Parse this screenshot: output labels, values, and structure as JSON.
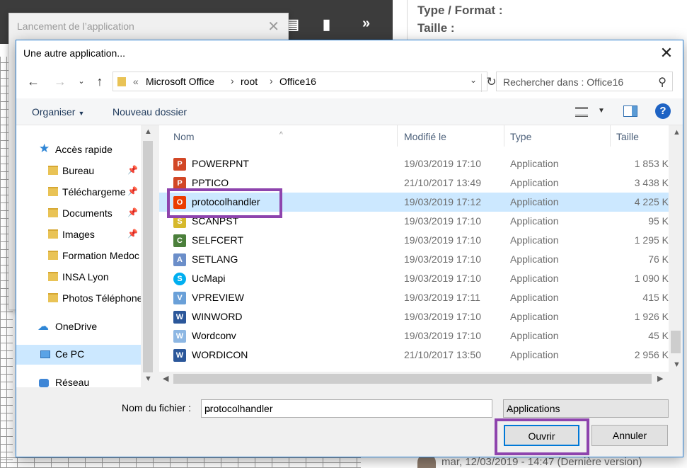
{
  "background": {
    "launcher_title": "Lancement de l’application",
    "type_format_label": "Type / Format :",
    "taille_label": "Taille :",
    "footer_text": "mar, 12/03/2019 - 14:47 (Dernière version)"
  },
  "dialog": {
    "title": "Une autre application...",
    "address": {
      "overflow": "«",
      "segments": [
        "Microsoft Office",
        "root",
        "Office16"
      ]
    },
    "search_placeholder": "Rechercher dans : Office16",
    "commands": {
      "organize": "Organiser",
      "new_folder": "Nouveau dossier"
    },
    "nav_items": [
      {
        "label": "Accès rapide",
        "icon": "star-icon"
      },
      {
        "label": "Bureau",
        "icon": "folder-icon",
        "pinned": true
      },
      {
        "label": "Téléchargements",
        "icon": "download-folder-icon",
        "pinned": true
      },
      {
        "label": "Documents",
        "icon": "documents-folder-icon",
        "pinned": true
      },
      {
        "label": "Images",
        "icon": "images-folder-icon",
        "pinned": true
      },
      {
        "label": "Formation Medoc",
        "icon": "folder-icon"
      },
      {
        "label": "INSA Lyon",
        "icon": "folder-icon"
      },
      {
        "label": "Photos Téléphone",
        "icon": "folder-icon"
      },
      {
        "label": "OneDrive",
        "icon": "cloud-icon"
      },
      {
        "label": "Ce PC",
        "icon": "computer-icon",
        "selected": true
      },
      {
        "label": "Réseau",
        "icon": "network-icon"
      }
    ],
    "columns": [
      "Nom",
      "Modifié le",
      "Type",
      "Taille"
    ],
    "files": [
      {
        "name": "POWERPNT",
        "modified": "19/03/2019 17:10",
        "type": "Application",
        "size": "1 853 K",
        "icon": "powerpoint-icon"
      },
      {
        "name": "PPTICO",
        "modified": "21/10/2017 13:49",
        "type": "Application",
        "size": "3 438 K",
        "icon": "powerpoint-icon"
      },
      {
        "name": "protocolhandler",
        "modified": "19/03/2019 17:12",
        "type": "Application",
        "size": "4 225 K",
        "icon": "office-icon",
        "selected": true
      },
      {
        "name": "SCANPST",
        "modified": "19/03/2019 17:10",
        "type": "Application",
        "size": "95 K",
        "icon": "scanpst-icon"
      },
      {
        "name": "SELFCERT",
        "modified": "19/03/2019 17:10",
        "type": "Application",
        "size": "1 295 K",
        "icon": "certificate-icon"
      },
      {
        "name": "SETLANG",
        "modified": "19/03/2019 17:10",
        "type": "Application",
        "size": "76 K",
        "icon": "language-icon"
      },
      {
        "name": "UcMapi",
        "modified": "19/03/2019 17:10",
        "type": "Application",
        "size": "1 090 K",
        "icon": "skype-icon"
      },
      {
        "name": "VPREVIEW",
        "modified": "19/03/2019 17:11",
        "type": "Application",
        "size": "415 K",
        "icon": "preview-icon"
      },
      {
        "name": "WINWORD",
        "modified": "19/03/2019 17:10",
        "type": "Application",
        "size": "1 926 K",
        "icon": "word-icon"
      },
      {
        "name": "Wordconv",
        "modified": "19/03/2019 17:10",
        "type": "Application",
        "size": "45 K",
        "icon": "wordconv-icon"
      },
      {
        "name": "WORDICON",
        "modified": "21/10/2017 13:50",
        "type": "Application",
        "size": "2 956 K",
        "icon": "word-icon"
      }
    ],
    "filename_label": "Nom du fichier :",
    "filename_value": "protocolhandler",
    "filetype_value": "Applications",
    "open_button": "Ouvrir",
    "cancel_button": "Annuler",
    "highlight_color": "#8e44ad",
    "selection_color": "#cce8ff",
    "accent_color": "#0078d7"
  }
}
